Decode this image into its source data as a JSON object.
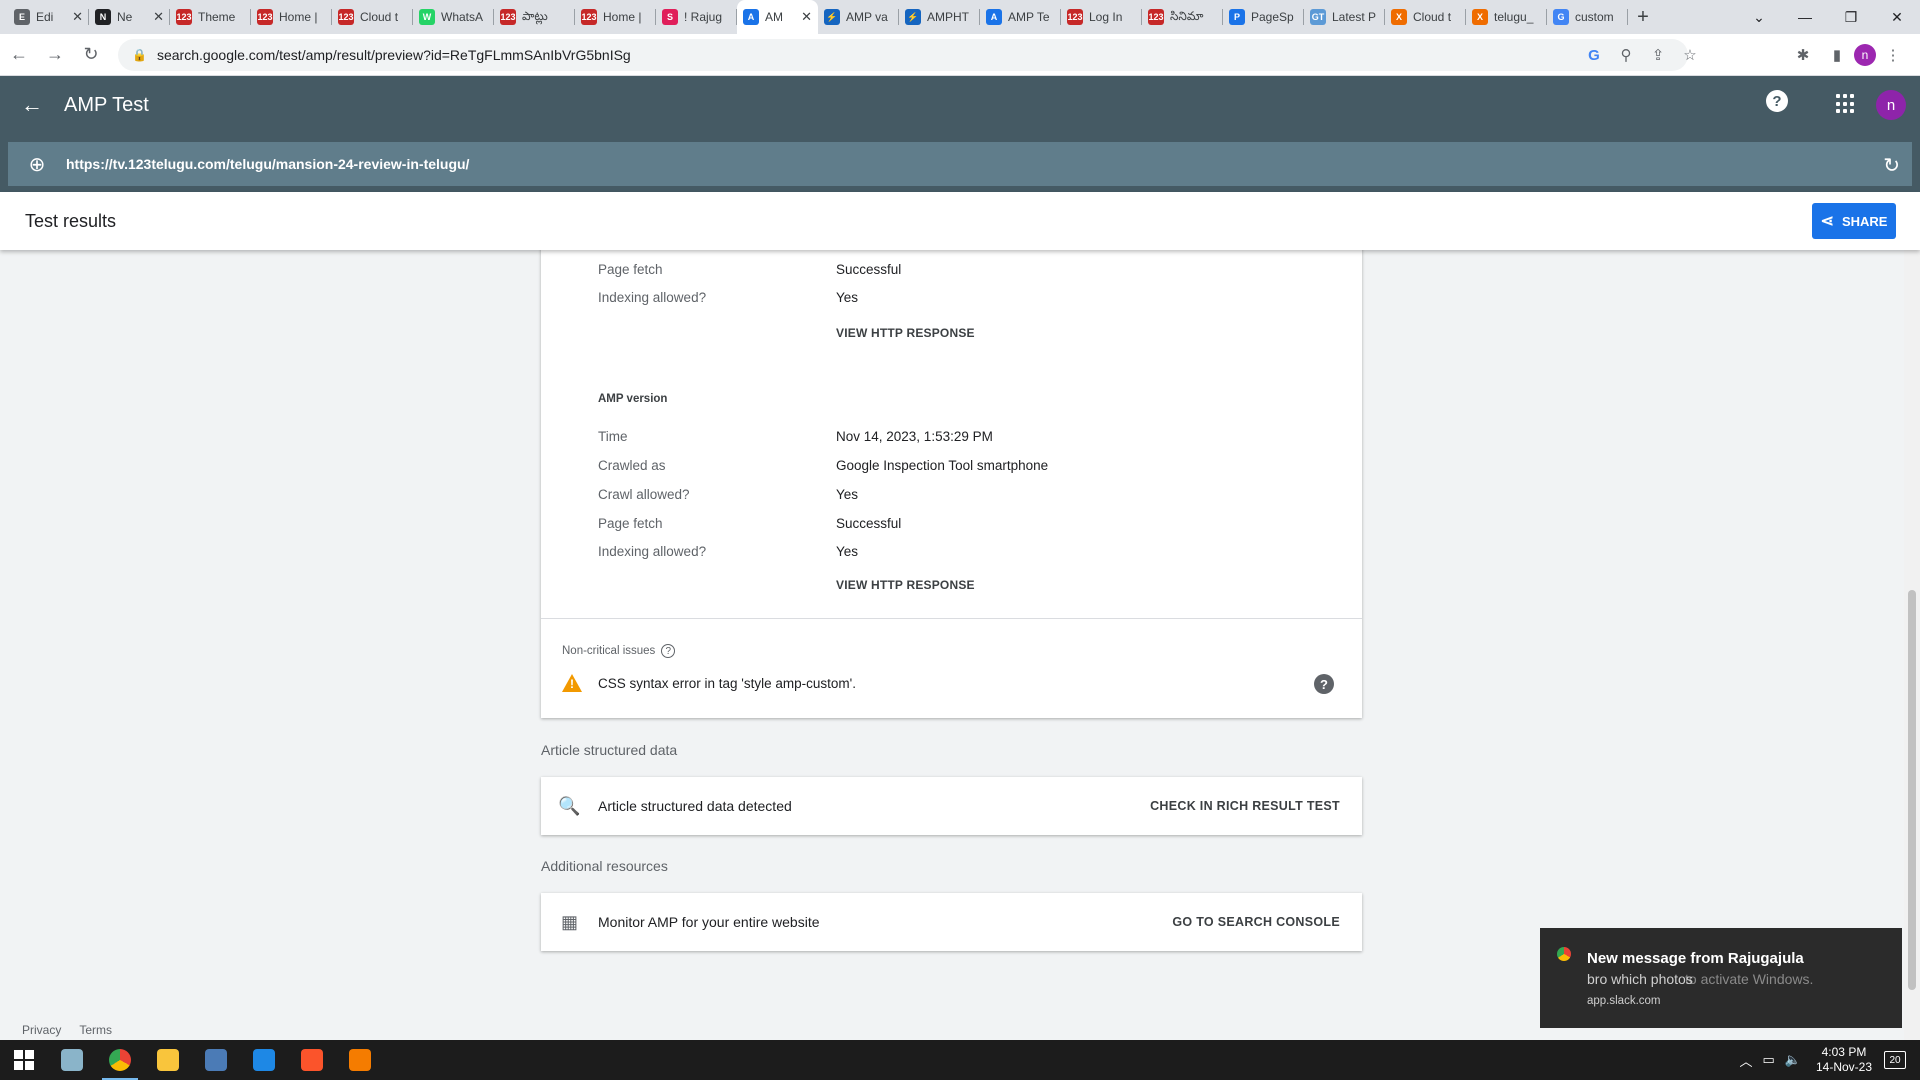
{
  "browser": {
    "tabs": [
      {
        "title": "Edi",
        "fav": "E",
        "color": "#5f6368"
      },
      {
        "title": "Ne",
        "fav": "N",
        "color": "#202124"
      },
      {
        "title": "Theme",
        "fav": "123",
        "color": "#c62828"
      },
      {
        "title": "Home |",
        "fav": "123",
        "color": "#c62828"
      },
      {
        "title": "Cloud t",
        "fav": "123",
        "color": "#c62828"
      },
      {
        "title": "WhatsA",
        "fav": "W",
        "color": "#25d366"
      },
      {
        "title": "పాట్లు",
        "fav": "123",
        "color": "#c62828"
      },
      {
        "title": "Home |",
        "fav": "123",
        "color": "#c62828"
      },
      {
        "title": "! Rajug",
        "fav": "S",
        "color": "#e01e5a"
      },
      {
        "title": "AM",
        "fav": "A",
        "color": "#1a73e8",
        "active": true
      },
      {
        "title": "AMP va",
        "fav": "⚡",
        "color": "#1565c0"
      },
      {
        "title": "AMPHT",
        "fav": "⚡",
        "color": "#1565c0"
      },
      {
        "title": "AMP Te",
        "fav": "A",
        "color": "#1a73e8"
      },
      {
        "title": "Log In",
        "fav": "123",
        "color": "#c62828"
      },
      {
        "title": "సినిమా",
        "fav": "123",
        "color": "#c62828"
      },
      {
        "title": "PageSp",
        "fav": "P",
        "color": "#1a73e8"
      },
      {
        "title": "Latest P",
        "fav": "GT",
        "color": "#5c9ad6"
      },
      {
        "title": "Cloud t",
        "fav": "X",
        "color": "#ef6c00"
      },
      {
        "title": "telugu_",
        "fav": "X",
        "color": "#ef6c00"
      },
      {
        "title": "custom",
        "fav": "G",
        "color": "#4285f4"
      }
    ],
    "address": "search.google.com/test/amp/result/preview?id=ReTgFLmmSAnIbVrG5bnISg",
    "profile_initial": "n"
  },
  "app": {
    "title": "AMP Test",
    "tested_url": "https://tv.123telugu.com/telugu/mansion-24-review-in-telugu/",
    "avatar_initial": "n",
    "results_title": "Test results",
    "share_label": "SHARE"
  },
  "canonical": {
    "rows": [
      {
        "key": "Page fetch",
        "value": "Successful"
      },
      {
        "key": "Indexing allowed?",
        "value": "Yes"
      }
    ],
    "link": "VIEW HTTP RESPONSE"
  },
  "amp_version": {
    "heading": "AMP version",
    "rows": [
      {
        "key": "Time",
        "value": "Nov 14, 2023, 1:53:29 PM"
      },
      {
        "key": "Crawled as",
        "value": "Google Inspection Tool smartphone"
      },
      {
        "key": "Crawl allowed?",
        "value": "Yes"
      },
      {
        "key": "Page fetch",
        "value": "Successful"
      },
      {
        "key": "Indexing allowed?",
        "value": "Yes"
      }
    ],
    "link": "VIEW HTTP RESPONSE"
  },
  "issues": {
    "label": "Non-critical issues",
    "item": "CSS syntax error in tag 'style amp-custom'."
  },
  "structured": {
    "title": "Article structured data",
    "label": "Article structured data detected",
    "action": "CHECK IN RICH RESULT TEST"
  },
  "resources": {
    "title": "Additional resources",
    "label": "Monitor AMP for your entire website",
    "action": "GO TO SEARCH CONSOLE"
  },
  "footer": {
    "privacy": "Privacy",
    "terms": "Terms"
  },
  "toast": {
    "title": "New message from Rajugajula",
    "body": "bro which photos",
    "watermark": "to activate Windows.",
    "source": "app.slack.com"
  },
  "taskbar": {
    "time": "4:03 PM",
    "date": "14-Nov-23",
    "notifications": "20"
  }
}
